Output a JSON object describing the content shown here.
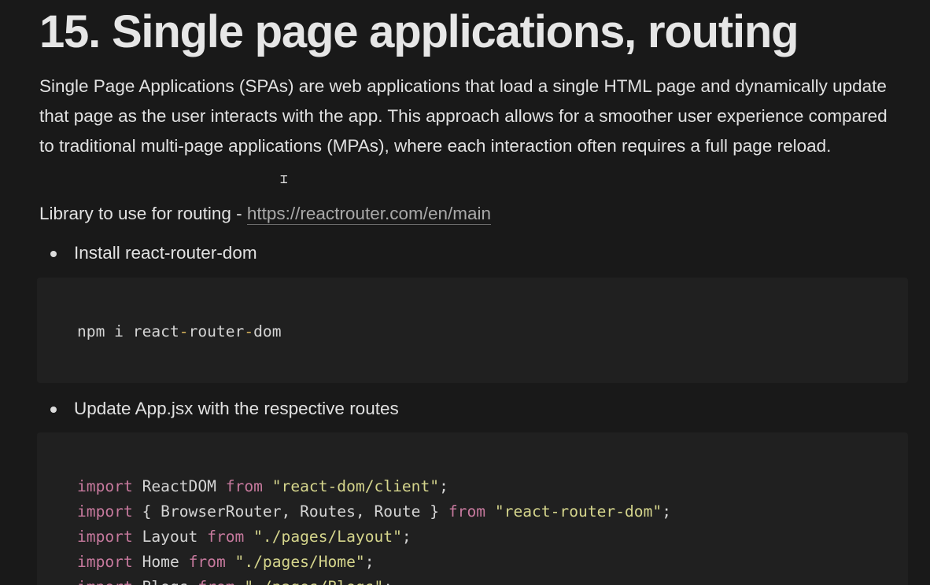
{
  "title": "15. Single page applications, routing",
  "intro": "Single Page Applications (SPAs) are web applications that load a single HTML page and dynamically update that page as the user interacts with the app. This approach allows for a smoother user experience compared to traditional multi-page applications (MPAs), where each interaction often requires a full page reload.",
  "library": {
    "label": "Library to use for routing - ",
    "link_text": "https://reactrouter.com/en/main"
  },
  "bullets": [
    {
      "text": "Install react-router-dom"
    },
    {
      "text": "Update App.jsx with the respective routes"
    }
  ],
  "code_install": {
    "parts": [
      "npm i react",
      "-",
      "router",
      "-",
      "dom"
    ]
  },
  "code_app": {
    "lines": [
      {
        "kw1": "import",
        "mid": " ReactDOM ",
        "kw2": "from",
        "sp": " ",
        "str": "\"react-dom/client\"",
        "end": ";"
      },
      {
        "kw1": "import",
        "mid": " { BrowserRouter, Routes, Route } ",
        "kw2": "from",
        "sp": " ",
        "str": "\"react-router-dom\"",
        "end": ";"
      },
      {
        "kw1": "import",
        "mid": " Layout ",
        "kw2": "from",
        "sp": " ",
        "str": "\"./pages/Layout\"",
        "end": ";"
      },
      {
        "kw1": "import",
        "mid": " Home ",
        "kw2": "from",
        "sp": " ",
        "str": "\"./pages/Home\"",
        "end": ";"
      },
      {
        "kw1": "import",
        "mid": " Blogs ",
        "kw2": "from",
        "sp": " ",
        "str": "\"./pages/Blogs\"",
        "end": ";"
      }
    ]
  },
  "colors": {
    "background": "#191919",
    "code_background": "#202020",
    "keyword": "#c6799d",
    "string": "#d5d58c",
    "link": "#a9a9a9"
  },
  "cursor_icon": "text-cursor-icon"
}
